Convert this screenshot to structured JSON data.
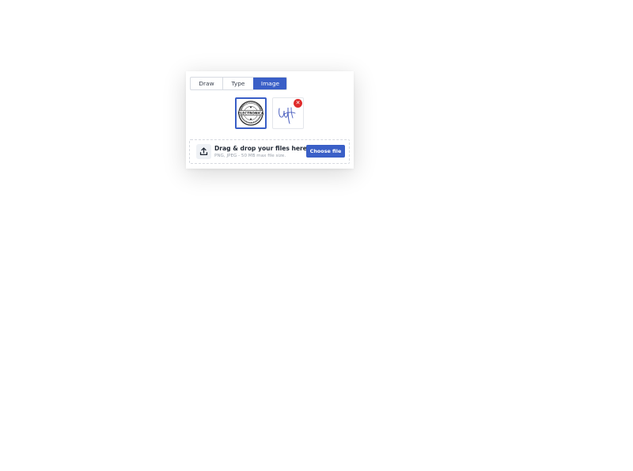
{
  "colors": {
    "accent": "#3a5fc7",
    "danger": "#e02b2b",
    "signature_ink": "#4a5fbf"
  },
  "tabs": [
    {
      "label": "Draw",
      "active": false
    },
    {
      "label": "Type",
      "active": false
    },
    {
      "label": "Image",
      "active": true
    }
  ],
  "thumbnails": [
    {
      "kind": "stamp",
      "selected": true
    },
    {
      "kind": "handwritten-signature",
      "selected": false,
      "removable": true
    }
  ],
  "stamp_text": "ELECTRONICA",
  "remove_icon": {
    "name": "close-icon",
    "glyph": "✕"
  },
  "dropzone": {
    "icon": "upload-icon",
    "title": "Drag & drop your files here",
    "subtitle": "PNG, JPEG - 50 MB max file size.",
    "button_label": "Choose file"
  }
}
